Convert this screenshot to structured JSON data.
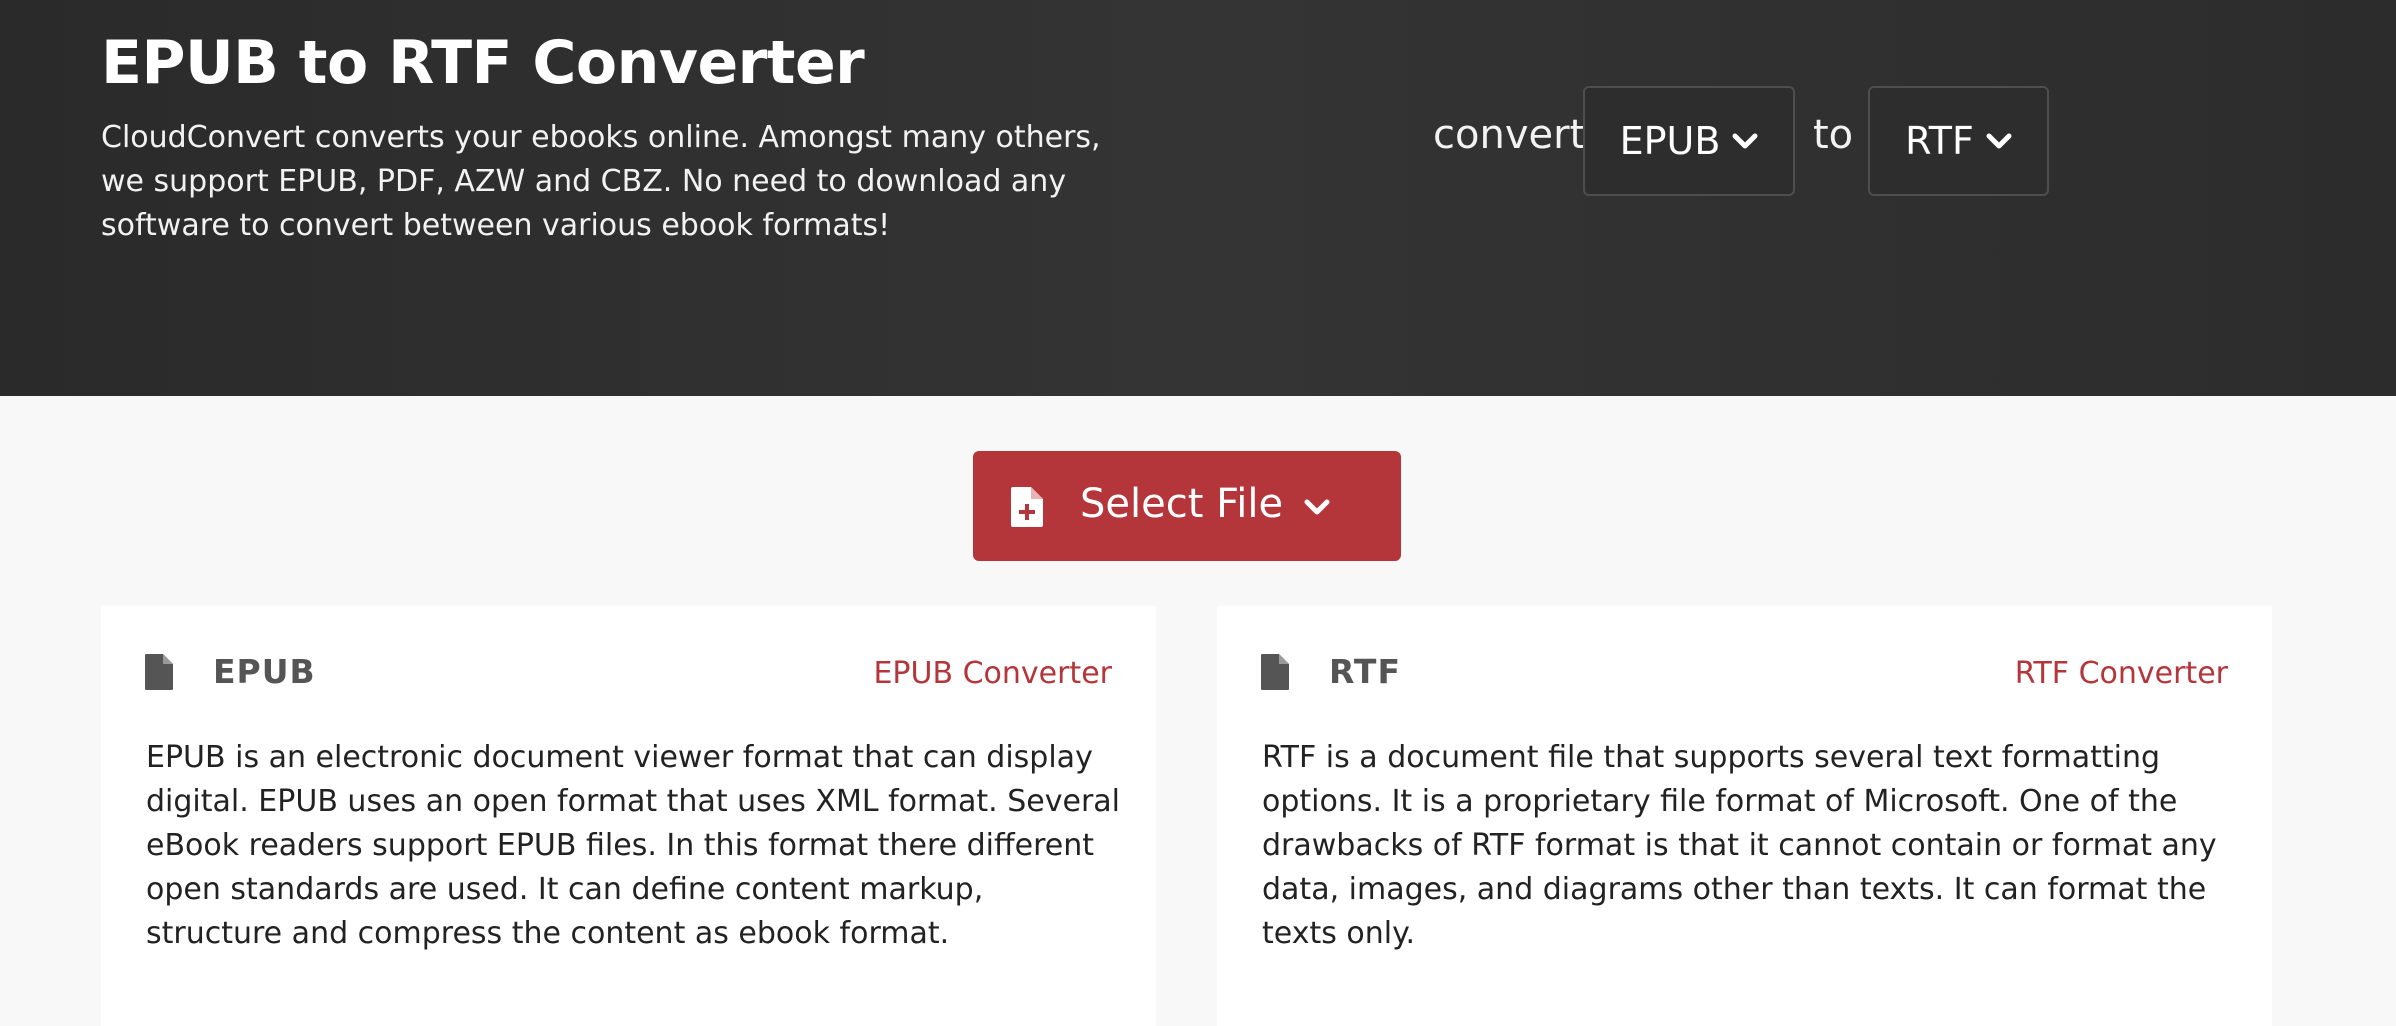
{
  "hero": {
    "title": "EPUB to RTF Converter",
    "description": "CloudConvert converts your ebooks online. Amongst many others, we support EPUB, PDF, AZW and CBZ. No need to download any software to convert between various ebook formats!",
    "convert_label": "convert",
    "to_label": "to",
    "from_format": "EPUB",
    "to_format": "RTF",
    "background_color": "#2f2f2f"
  },
  "select_file": {
    "label": "Select File",
    "color": "#b5363a",
    "icon": "file-plus-icon"
  },
  "cards": [
    {
      "title": "EPUB",
      "link": "EPUB Converter",
      "icon": "file-icon",
      "text": "EPUB is an electronic document viewer format that can display digital. EPUB uses an open format that uses XML format. Several eBook readers support EPUB files. In this format there different open standards are used. It can define content markup, structure and compress the content as ebook format."
    },
    {
      "title": "RTF",
      "link": "RTF Converter",
      "icon": "file-icon",
      "text": "RTF is a document file that supports several text formatting options. It is a proprietary file format of Microsoft. One of the drawbacks of RTF format is that it cannot contain or format any data, images, and diagrams other than texts. It can format the texts only."
    }
  ]
}
